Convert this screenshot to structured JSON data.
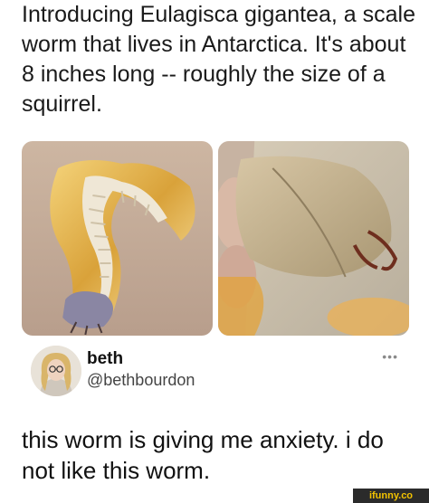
{
  "caption": "Introducing Eulagisca gigantea, a scale worm that lives in Antarctica. It's about 8 inches long -- roughly the size of a squirrel.",
  "tweet": {
    "display_name": "beth",
    "handle": "@bethbourdon",
    "more_label": "•••",
    "text": "this worm is giving me anxiety. i do not like this worm."
  },
  "watermark": "ifunny.co",
  "icons": [
    "worm-photo",
    "worm-closeup-photo",
    "avatar",
    "more-icon"
  ]
}
